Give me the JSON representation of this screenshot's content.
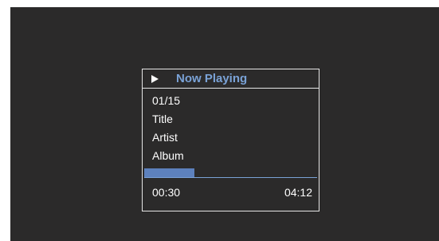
{
  "player": {
    "title": "Now Playing",
    "icon": "play-icon",
    "track_number": "01/15",
    "song": "Title",
    "artist": "Artist",
    "album": "Album",
    "progress_fraction": 0.29,
    "elapsed": "00:30",
    "total": "04:12"
  },
  "colors": {
    "screen_background": "#2b2a2a",
    "accent": "#7aa2d6",
    "progress": "#5d81bd",
    "text": "#ffffff"
  }
}
